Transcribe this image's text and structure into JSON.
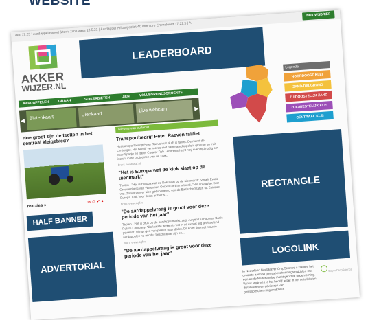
{
  "caption": "WEBSITE",
  "site": {
    "ticker": "dec 17:25 | Aardappel export álterni zijn Grass 18,5.21 | Aardappel Prikadgeziist 40 mm vpre Emmeloord 17:22,5 | A",
    "newsletter_label": "NIEUWSBRIEF",
    "logo_line1": "AKKER",
    "logo_line2": "WIJZER.NL",
    "leaderboard_label": "LEADERBOARD",
    "nav": [
      "AARDAPPELEN",
      "GRAAN",
      "SUIKERBIETEN",
      "UIEN",
      "VOLLEGRONDSGROENTE"
    ],
    "slider": [
      {
        "label": "Bietenkaart"
      },
      {
        "label": "Uienkaart"
      },
      {
        "label": "Live webcam"
      }
    ],
    "legend": {
      "title": "Legenda",
      "items": [
        {
          "label": "NOORDOOST KLEI",
          "color": "#f0a23a"
        },
        {
          "label": "ZAND-DALGROND",
          "color": "#f4c23d"
        },
        {
          "label": "ZUIDOOSTELIJK ZAND",
          "color": "#d24a4a"
        },
        {
          "label": "ZUIDWESTELIJK KLEI",
          "color": "#9c4fb8"
        },
        {
          "label": "CENTRAAL KLEI",
          "color": "#1e9fcf"
        }
      ]
    },
    "teaser_title": "Hoe groot zijn de teelten in het centraal kleigebied?",
    "reacties_label": "reacties »",
    "half_banner_label": "HALF BANNER",
    "advertorial_label": "ADVERTORIAL",
    "news_header": "Nieuws van buitenaf",
    "news": [
      {
        "title": "Transportbedrijf Peter Raeven failliet",
        "body": "Het transportbedrijf Peter Raeven uit Nuth is failliet. De markt de Limburger. Het bedrijf vervoerde met name aardappelen, groente en fruit naar Spanje en Italië. Curator Rob Lemmens heeft nog even tijd nodig om inzicht in de problemen van de zaak.",
        "source": "bron: www.agf.nl"
      },
      {
        "title": "\"Het is Europa wat de klok slaat op de uienmarkt\"",
        "body": "Tholen - \"Het is Europa wat de klok slaat op de uienmarkt\", vertelt Ewald Grouwenberg van Weterman Onions uit Emmeloord. \"Het draagvlak is er wel. Zo worden er uien geëxporteerd van de Baltische Staten tot Zuidoost-Europa. Ook hoor ik dat er hier s ...",
        "source": "bron: www.agf.nl"
      },
      {
        "title": "\"De aardappelvraag is groot voor deze periode van het jaar\"",
        "body": "Tholen - Het is druk op de aardappelmarkt, zegt Jurgen Duthoo van Bart's Potato Company. \"De laatste weken is het in de export erg afwisselend geweest. We gingen van pieken naar dalen. Dit komt doordat nieuwe aardappelen nu minder beschikbaar zijn en...",
        "source": "bron: www.agf.nl"
      },
      {
        "title": "\"De aardappelvraag is groot voor deze periode van het jaar\"",
        "body": "",
        "source": ""
      }
    ],
    "rectangle_label": "RECTANGLE",
    "logolink_label": "LOGOLINK",
    "bayer_text": "In Nederland biedt Bayer CropScience u klanten het grootste aanbod gewasbeschermingsmiddelen met een op de Nederlandse markt gerichte onderneming. Vanuit Mijdrecht is het bedrijf actief in het ontwikkelen, distribueren en adviseren van gewasbeschermingsmiddelen",
    "bayer_logo_text": "Bayer CropScience"
  },
  "colors": {
    "ad_blue": "#1f4e73",
    "brand_green": "#2e7d2e",
    "news_green": "#7cba3c"
  }
}
